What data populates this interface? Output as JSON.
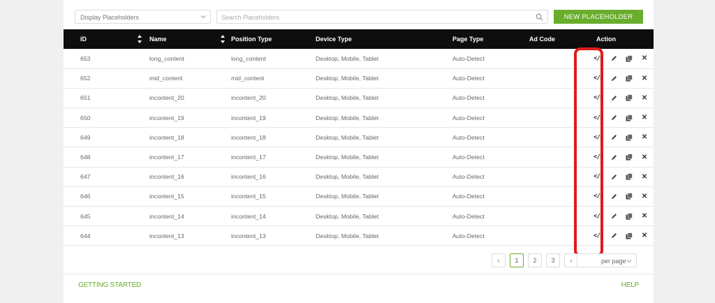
{
  "toolbar": {
    "filter_value": "Display Placeholders",
    "search_placeholder": "Search Placeholders",
    "new_button": "NEW PLACEHOLDER"
  },
  "table": {
    "headers": {
      "id": "ID",
      "name": "Name",
      "position_type": "Position Type",
      "device_type": "Device Type",
      "page_type": "Page Type",
      "ad_code": "Ad Code",
      "action": "Action"
    },
    "rows": [
      {
        "id": "653",
        "name": "long_content",
        "position": "long_content",
        "device": "Desktop, Mobile, Tablet",
        "page": "Auto-Detect"
      },
      {
        "id": "652",
        "name": "mid_content",
        "position": "mid_content",
        "device": "Desktop, Mobile, Tablet",
        "page": "Auto-Detect"
      },
      {
        "id": "651",
        "name": "incontent_20",
        "position": "incontent_20",
        "device": "Desktop, Mobile, Tablet",
        "page": "Auto-Detect"
      },
      {
        "id": "650",
        "name": "incontent_19",
        "position": "incontent_19",
        "device": "Desktop, Mobile, Tablet",
        "page": "Auto-Detect"
      },
      {
        "id": "649",
        "name": "incontent_18",
        "position": "incontent_18",
        "device": "Desktop, Mobile, Tablet",
        "page": "Auto-Detect"
      },
      {
        "id": "648",
        "name": "incontent_17",
        "position": "incontent_17",
        "device": "Desktop, Mobile, Tablet",
        "page": "Auto-Detect"
      },
      {
        "id": "647",
        "name": "incontent_16",
        "position": "incontent_16",
        "device": "Desktop, Mobile, Tablet",
        "page": "Auto-Detect"
      },
      {
        "id": "646",
        "name": "incontent_15",
        "position": "incontent_15",
        "device": "Desktop, Mobile, Tablet",
        "page": "Auto-Detect"
      },
      {
        "id": "645",
        "name": "incontent_14",
        "position": "incontent_14",
        "device": "Desktop, Mobile, Tablet",
        "page": "Auto-Detect"
      },
      {
        "id": "644",
        "name": "incontent_13",
        "position": "incontent_13",
        "device": "Desktop, Mobile, Tablet",
        "page": "Auto-Detect"
      }
    ],
    "action_icons": {
      "code": "</>",
      "edit": "pencil-icon",
      "copy": "copy-icon",
      "delete": "✕"
    }
  },
  "pagination": {
    "prev": "‹",
    "pages": [
      "1",
      "2",
      "3"
    ],
    "active_page": "1",
    "next": "›",
    "per_page_label": "per page"
  },
  "footer": {
    "left_link": "GETTING STARTED",
    "right_link": "HELP"
  },
  "colors": {
    "accent": "#6aad2d",
    "header_bg": "#0e0e0e",
    "highlight": "#e01b1b"
  }
}
